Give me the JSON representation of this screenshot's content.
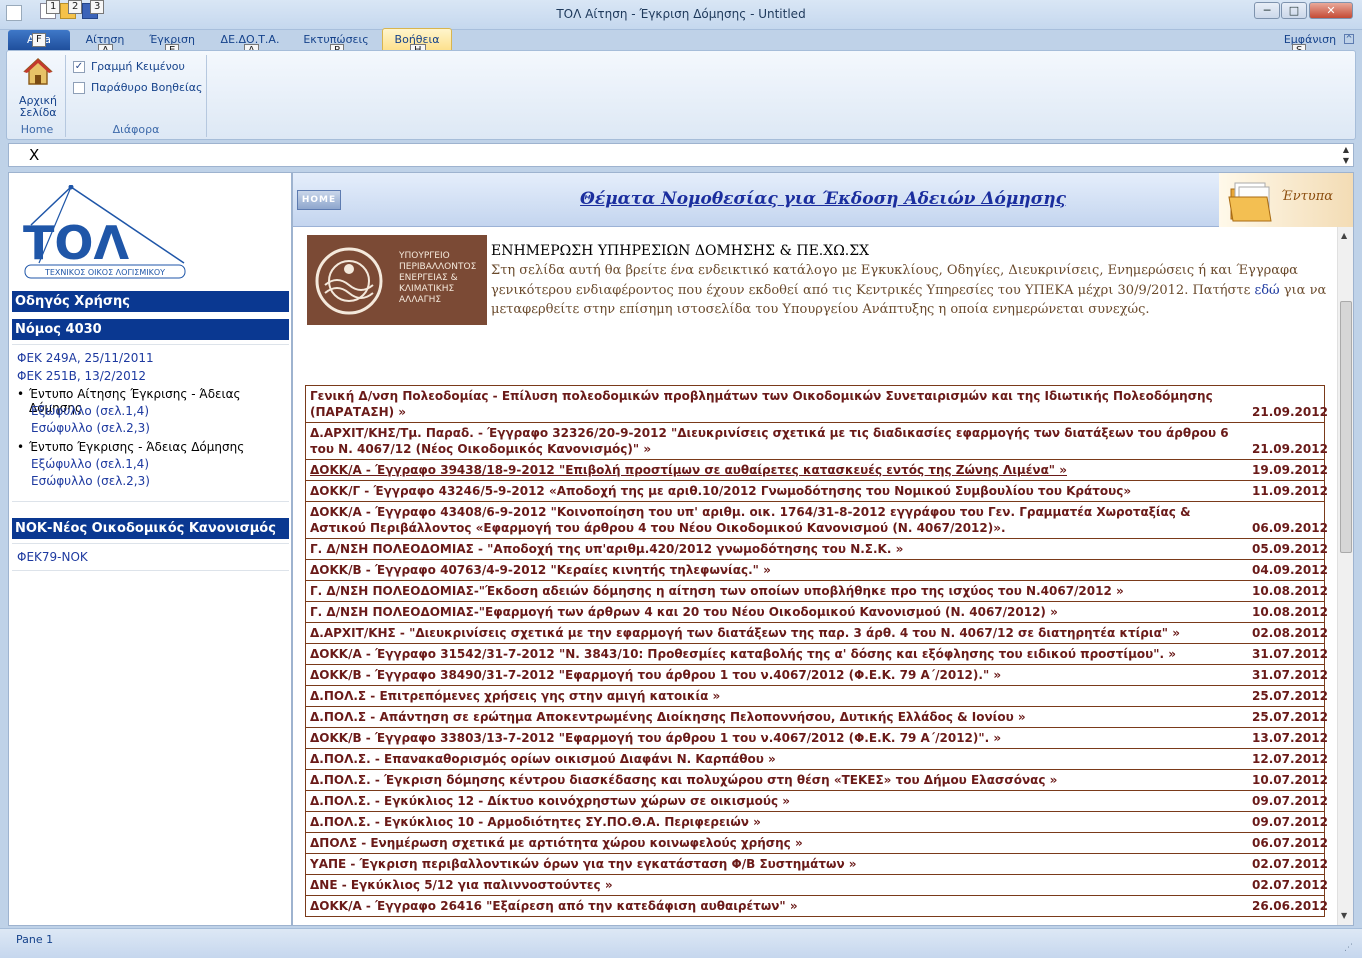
{
  "window": {
    "title": "ΤΟΛ Αίτηση - Έγκριση Δόμησης - Untitled",
    "keytips": [
      "1",
      "2",
      "3"
    ],
    "min": "─",
    "max": "□",
    "close": "✕"
  },
  "menu": {
    "file": "AF a",
    "file_tip": "F",
    "tabs": [
      {
        "label": "Αίτηση",
        "tip": "A"
      },
      {
        "label": "Έγκριση",
        "tip": "E"
      },
      {
        "label": "ΔΕ.ΔΟ.Τ.Α.",
        "tip": "Δ"
      },
      {
        "label": "Εκτυπώσεις",
        "tip": "P"
      },
      {
        "label": "Βοήθεια",
        "tip": "H"
      }
    ],
    "view": "Εμφάνιση",
    "view_tip": "S"
  },
  "ribbon": {
    "home_label_1": "Αρχική",
    "home_label_2": "Σελίδα",
    "home_group": "Home",
    "chk1": "Γραμμή Κειμένου",
    "chk1_checked": "✓",
    "chk2": "Παράθυρο Βοηθείας",
    "misc_group": "Διάφορα"
  },
  "address": {
    "value": "X"
  },
  "left": {
    "logo_text": "ΤΟΛ",
    "logo_sub": "ΤΕΧΝΙΚΟΣ ΟΙΚΟΣ ΛΟΓΙΣΜΙΚΟΥ",
    "h1": "Οδηγός Χρήσης",
    "h2": "Νόμος 4030",
    "l1": "ΦΕΚ 249Α, 25/11/2011",
    "l2": "ΦΕΚ 251Β, 13/2/2012",
    "b1": "Έντυπο Αίτησης Έγκρισης - Άδειας Δόμησης",
    "b1a": "Εξώφυλλο (σελ.1,4)",
    "b1b": "Εσώφυλλο (σελ.2,3)",
    "b2": "Έντυπο Έγκρισης - Άδειας Δόμησης",
    "b2a": "Εξώφυλλο (σελ.1,4)",
    "b2b": "Εσώφυλλο (σελ.2,3)",
    "h3": "ΝΟΚ-Νέος Οικοδομικός Κανονισμός",
    "l3": "ΦΕΚ79-ΝΟΚ"
  },
  "main": {
    "home": "HOME",
    "title": "Θέματα Νομοθεσίας για Έκδοση Αδειών Δόμησης",
    "entypa": "Έντυπα",
    "ministry": [
      "ΥΠΟΥΡΓΕΙΟ",
      "ΠΕΡΙΒΑΛΛΟΝΤΟΣ",
      "ΕΝΕΡΓΕΙΑΣ &",
      "ΚΛΙΜΑΤΙΚΗΣ",
      "ΑΛΛΑΓΗΣ"
    ],
    "heading": "ΕΝΗΜΕΡΩΣΗ ΥΠΗΡΕΣΙΩΝ ΔΟΜΗΣΗΣ & ΠΕ.ΧΩ.ΣΧ",
    "intro1": "Στη σελίδα αυτή θα βρείτε ένα ενδεικτικό κατάλογο με Εγκυκλίους, Οδηγίες, Διευκρινίσεις, Ενημερώσεις ή και Έγγραφα",
    "intro2a": "γενικότερου ενδιαφέροντος που έχουν εκδοθεί από τις Κεντρικές Υπηρεσίες του ΥΠΕΚΑ μέχρι 30/9/2012. Πατήστε ",
    "intro2link": "εδώ",
    "intro2b": " για να",
    "intro3": "μεταφερθείτε στην επίσημη ιστοσελίδα του Υπουργείου Ανάπτυξης η οποία ενημερώνεται συνεχώς.",
    "rows": [
      {
        "t": "Γενική Δ/νση Πολεοδομίας - Επίλυση πολεοδομικών προβλημάτων των Οικοδομικών Συνεταιρισμών και της Ιδιωτικής Πολεοδόμησης (ΠΑΡΑΤΑΣΗ) »",
        "d": "21.09.2012"
      },
      {
        "t": "Δ.ΑΡΧΙΤ/ΚΗΣ/Τμ. Παραδ. - Έγγραφο 32326/20-9-2012 \"Διευκρινίσεις σχετικά με τις διαδικασίες εφαρμογής των διατάξεων του άρθρου 6 του Ν. 4067/12 (Νέος Οικοδομικός Κανονισμός)\" »",
        "d": "21.09.2012"
      },
      {
        "t": "ΔΟΚΚ/Α - Έγγραφο 39438/18-9-2012 \"Επιβολή προστίμων σε αυθαίρετες κατασκευές εντός της Ζώνης Λιμένα\" »",
        "d": "19.09.2012",
        "u": true
      },
      {
        "t": "ΔΟΚΚ/Γ - Έγγραφο 43246/5-9-2012 «Αποδοχή της με αριθ.10/2012 Γνωμοδότησης του Νομικού Συμβουλίου του Κράτους»",
        "d": "11.09.2012"
      },
      {
        "t": "ΔΟΚΚ/Α - Έγγραφο 43408/6-9-2012 \"Κοινοποίηση του υπ' αριθμ. οικ. 1764/31-8-2012 εγγράφου του Γεν. Γραμματέα Χωροταξίας & Αστικού Περιβάλλοντος «Εφαρμογή του άρθρου 4 του Νέου Οικοδομικού Κανονισμού (Ν. 4067/2012)».",
        "d": "06.09.2012"
      },
      {
        "t": "Γ. Δ/ΝΣΗ ΠΟΛΕΟΔΟΜΙΑΣ - \"Αποδοχή της υπ'αριθμ.420/2012 γνωμοδότησης του Ν.Σ.Κ. »",
        "d": "05.09.2012"
      },
      {
        "t": "ΔΟΚΚ/Β - Έγγραφο 40763/4-9-2012 \"Κεραίες κινητής τηλεφωνίας.\" »",
        "d": "04.09.2012"
      },
      {
        "t": "Γ. Δ/ΝΣΗ ΠΟΛΕΟΔΟΜΙΑΣ-\"Έκδοση αδειών δόμησης η αίτηση των οποίων υποβλήθηκε προ της ισχύος του Ν.4067/2012 »",
        "d": "10.08.2012"
      },
      {
        "t": "Γ. Δ/ΝΣΗ ΠΟΛΕΟΔΟΜΙΑΣ-\"Εφαρμογή των άρθρων 4 και 20 του Νέου Οικοδομικού Κανονισμού (Ν. 4067/2012) »",
        "d": "10.08.2012"
      },
      {
        "t": "Δ.ΑΡΧΙΤ/ΚΗΣ - \"Διευκρινίσεις σχετικά με την εφαρμογή των διατάξεων της παρ. 3 άρθ. 4 του Ν. 4067/12 σε διατηρητέα κτίρια\" »",
        "d": "02.08.2012"
      },
      {
        "t": "ΔΟΚΚ/Α - Έγγραφο 31542/31-7-2012 \"Ν. 3843/10: Προθεσμίες καταβολής της α' δόσης και εξόφλησης του ειδικού προστίμου\". »",
        "d": "31.07.2012"
      },
      {
        "t": "ΔΟΚΚ/Β - Έγγραφο 38490/31-7-2012 \"Εφαρμογή του άρθρου 1 του ν.4067/2012 (Φ.Ε.Κ. 79 Α΄/2012).\" »",
        "d": "31.07.2012"
      },
      {
        "t": "Δ.ΠΟΛ.Σ - Επιτρεπόμενες χρήσεις γης στην αμιγή κατοικία »",
        "d": "25.07.2012"
      },
      {
        "t": "Δ.ΠΟΛ.Σ - Απάντηση σε ερώτημα Αποκεντρωμένης Διοίκησης Πελοποννήσου, Δυτικής Ελλάδος & Ιονίου »",
        "d": "25.07.2012"
      },
      {
        "t": "ΔΟΚΚ/Β - Έγγραφο 33803/13-7-2012 \"Εφαρμογή του άρθρου 1 του ν.4067/2012 (Φ.Ε.Κ. 79 Α΄/2012)\". »",
        "d": "13.07.2012"
      },
      {
        "t": "Δ.ΠΟΛ.Σ. - Επανακαθορισμός ορίων οικισμού Διαφάνι Ν. Καρπάθου »",
        "d": "12.07.2012"
      },
      {
        "t": "Δ.ΠΟΛ.Σ. - Έγκριση δόμησης κέντρου διασκέδασης και πολυχώρου στη θέση «ΤΕΚΕΣ» του Δήμου Ελασσόνας »",
        "d": "10.07.2012"
      },
      {
        "t": "Δ.ΠΟΛ.Σ. - Εγκύκλιος 12 - Δίκτυο κοινόχρηστων χώρων σε οικισμούς »",
        "d": "09.07.2012"
      },
      {
        "t": "Δ.ΠΟΛ.Σ. - Εγκύκλιος 10 - Αρμοδιότητες ΣΥ.ΠΟ.Θ.Α. Περιφερειών »",
        "d": "09.07.2012"
      },
      {
        "t": "ΔΠΟΛΣ - Ενημέρωση σχετικά με αρτιότητα χώρου κοινωφελούς χρήσης »",
        "d": "06.07.2012"
      },
      {
        "t": "ΥΑΠΕ - Έγκριση περιβαλλοντικών όρων για την εγκατάσταση Φ/Β Συστημάτων »",
        "d": "02.07.2012"
      },
      {
        "t": "ΔΝΕ - Εγκύκλιος 5/12 για παλιννοστούντες »",
        "d": "02.07.2012"
      },
      {
        "t": "ΔΟΚΚ/Α - Έγγραφο 26416 \"Εξαίρεση από την κατεδάφιση αυθαιρέτων\" »",
        "d": "26.06.2012"
      }
    ]
  },
  "status": {
    "pane": "Pane 1"
  }
}
